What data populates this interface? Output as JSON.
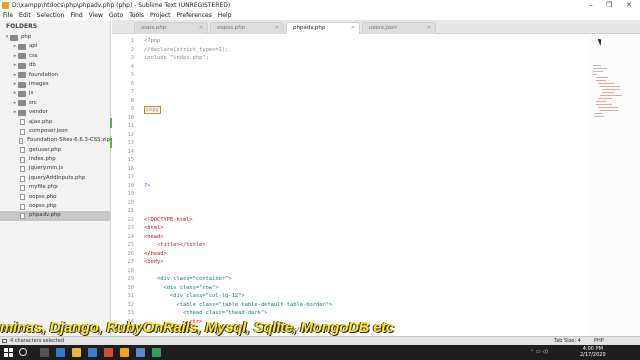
{
  "window": {
    "title": "D:\\xampp\\htdocs\\php\\phpadv.php (php) - Sublime Text (UNREGISTERED)",
    "controls": [
      "–",
      "❐",
      "✕"
    ]
  },
  "menu": [
    "File",
    "Edit",
    "Selection",
    "Find",
    "View",
    "Goto",
    "Tools",
    "Project",
    "Preferences",
    "Help"
  ],
  "sidebar": {
    "title": "FOLDERS",
    "items": [
      {
        "label": "php",
        "type": "folder",
        "depth": 0,
        "open": true
      },
      {
        "label": "api",
        "type": "folder",
        "depth": 1
      },
      {
        "label": "css",
        "type": "folder",
        "depth": 1
      },
      {
        "label": "db",
        "type": "folder",
        "depth": 1
      },
      {
        "label": "foundation",
        "type": "folder",
        "depth": 1
      },
      {
        "label": "images",
        "type": "folder",
        "depth": 1
      },
      {
        "label": "js",
        "type": "folder",
        "depth": 1
      },
      {
        "label": "src",
        "type": "folder",
        "depth": 1
      },
      {
        "label": "vendor",
        "type": "folder",
        "depth": 1
      },
      {
        "label": "ajax.php",
        "type": "file",
        "depth": 1
      },
      {
        "label": "composer.json",
        "type": "file",
        "depth": 1
      },
      {
        "label": "Foundation-Sites-6.6.3-CSS.zip",
        "type": "file",
        "depth": 1
      },
      {
        "label": "getuser.php",
        "type": "file",
        "depth": 1
      },
      {
        "label": "index.php",
        "type": "file",
        "depth": 1
      },
      {
        "label": "jquery.min.js",
        "type": "file",
        "depth": 1
      },
      {
        "label": "jqueryAddInputs.php",
        "type": "file",
        "depth": 1
      },
      {
        "label": "myfile.php",
        "type": "file",
        "depth": 1
      },
      {
        "label": "oopss.php",
        "type": "file",
        "depth": 1
      },
      {
        "label": "oopss.php",
        "type": "file",
        "depth": 1
      },
      {
        "label": "phpadv.php",
        "type": "file",
        "depth": 1,
        "selected": true
      }
    ]
  },
  "tabs": [
    {
      "label": "oops.php",
      "active": false
    },
    {
      "label": "oopss.php",
      "active": false
    },
    {
      "label": "phpadv.php",
      "active": true
    },
    {
      "label": "users.json",
      "active": false
    }
  ],
  "editor": {
    "lines": [
      {
        "n": "1",
        "text": "<?php",
        "color": "gray"
      },
      {
        "n": "2",
        "text": "//declare(strict_types=1);",
        "color": "gray"
      },
      {
        "n": "3",
        "text": "include \"index.php\";",
        "color": "gray"
      },
      {
        "n": "4",
        "text": "",
        "color": "gray"
      },
      {
        "n": "5",
        "text": "",
        "color": "gray"
      },
      {
        "n": "6",
        "text": "",
        "color": "gray"
      },
      {
        "n": "7",
        "text": "",
        "color": "gray"
      },
      {
        "n": "8",
        "text": "",
        "color": "gray"
      },
      {
        "n": "9",
        "text": "©opy",
        "color": "sel"
      },
      {
        "n": "10",
        "text": "",
        "color": "gray"
      },
      {
        "n": "11",
        "text": "",
        "color": "gray"
      },
      {
        "n": "12",
        "text": "",
        "color": "gray"
      },
      {
        "n": "13",
        "text": "",
        "color": "gray"
      },
      {
        "n": "14",
        "text": "",
        "color": "gray"
      },
      {
        "n": "15",
        "text": "",
        "color": "gray"
      },
      {
        "n": "16",
        "text": "",
        "color": "gray"
      },
      {
        "n": "17",
        "text": "",
        "color": "gray"
      },
      {
        "n": "18",
        "text": "?>",
        "color": "blue"
      },
      {
        "n": "19",
        "text": "",
        "color": "gray"
      },
      {
        "n": "20",
        "text": "",
        "color": "gray"
      },
      {
        "n": "21",
        "text": "",
        "color": "gray"
      },
      {
        "n": "22",
        "text": "<!DOCTYPE html>",
        "color": "tag"
      },
      {
        "n": "23",
        "text": "<html>",
        "color": "tag"
      },
      {
        "n": "24",
        "text": "<head>",
        "color": "tag"
      },
      {
        "n": "25",
        "text": "    <title></title>",
        "color": "tag"
      },
      {
        "n": "26",
        "text": "</head>",
        "color": "tag"
      },
      {
        "n": "27",
        "text": "<body>",
        "color": "tag"
      },
      {
        "n": "28",
        "text": "",
        "color": "gray"
      },
      {
        "n": "29",
        "text": "    <div class=\"container\">",
        "color": "mixed"
      },
      {
        "n": "30",
        "text": "      <div class=\"row\">",
        "color": "mixed"
      },
      {
        "n": "31",
        "text": "        <div class=\"col-lg-12\">",
        "color": "mixed"
      },
      {
        "n": "32",
        "text": "          <table class=\"table table-default table-border\">",
        "color": "mixed"
      },
      {
        "n": "33",
        "text": "            <thead class=\"thead-dark\">",
        "color": "mixed"
      },
      {
        "n": "34",
        "text": "              <tr>",
        "color": "tag"
      },
      {
        "n": "35",
        "text": "                                        ction:</h4>",
        "color": "tag"
      }
    ]
  },
  "caption": "minas, Django, RubyOnRails, Mysql, Sqlite, MongoDB etc",
  "status": {
    "left": "4 characters selected",
    "tab_size": "Tab Size: 4",
    "syntax": "PHP"
  },
  "taskbar": {
    "time": "4:00 PM",
    "date": "2/17/2020"
  }
}
